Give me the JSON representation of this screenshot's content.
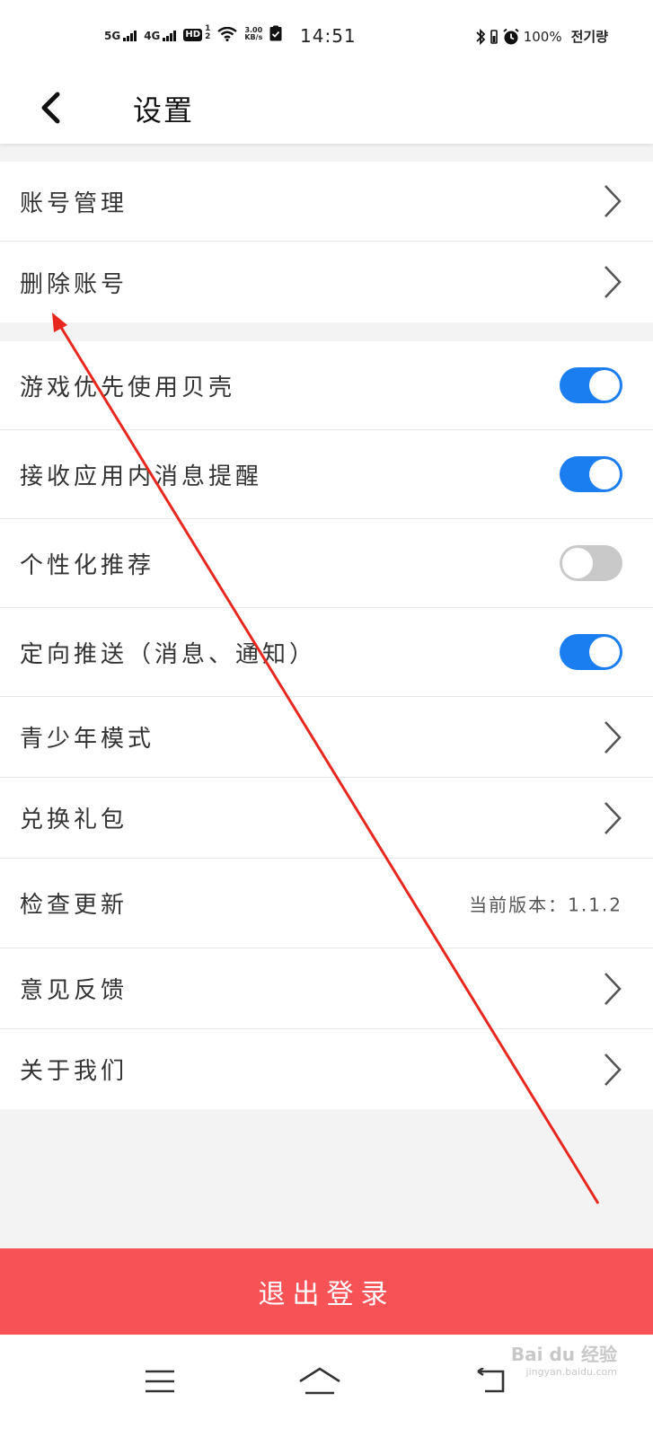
{
  "status_bar": {
    "net1": "5G",
    "net2": "4G",
    "hd": "HD",
    "hd_sup": "1",
    "hd_sub": "2",
    "speed_value": "3.00",
    "speed_unit": "KB/s",
    "time": "14:51",
    "battery": "100%",
    "carrier": "전기량"
  },
  "header": {
    "title": "设置"
  },
  "group1": [
    {
      "label": "账号管理",
      "control": "chevron"
    },
    {
      "label": "删除账号",
      "control": "chevron"
    }
  ],
  "group2": [
    {
      "label": "游戏优先使用贝壳",
      "control": "toggle",
      "on": true
    },
    {
      "label": "接收应用内消息提醒",
      "control": "toggle",
      "on": true
    },
    {
      "label": "个性化推荐",
      "control": "toggle",
      "on": false
    },
    {
      "label": "定向推送（消息、通知）",
      "control": "toggle",
      "on": true
    },
    {
      "label": "青少年模式",
      "control": "chevron"
    },
    {
      "label": "兑换礼包",
      "control": "chevron"
    },
    {
      "label": "检查更新",
      "control": "value",
      "value": "当前版本：1.1.2"
    },
    {
      "label": "意见反馈",
      "control": "chevron"
    },
    {
      "label": "关于我们",
      "control": "chevron"
    }
  ],
  "logout": {
    "label": "退出登录"
  },
  "watermark": {
    "brand": "Bai du 经验",
    "url": "jingyan.baidu.com"
  },
  "colors": {
    "toggle_on": "#1b7ef0",
    "toggle_off": "#c9c9c9",
    "logout_bg": "#f75356",
    "annotation_arrow": "#e8281e"
  }
}
